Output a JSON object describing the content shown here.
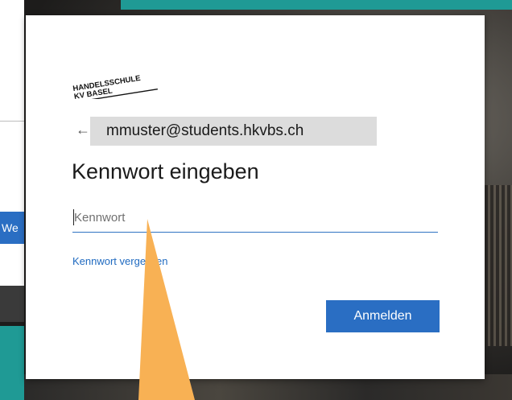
{
  "background": {
    "left_button_fragment": "We"
  },
  "logo": {
    "line1": "HANDELSSCHULE",
    "line2": "KV BASEL"
  },
  "header": {
    "back_icon": "arrow-left-icon",
    "account": "mmuster@students.hkvbs.ch"
  },
  "main": {
    "title": "Kennwort eingeben",
    "password": {
      "value": "",
      "placeholder": "Kennwort"
    },
    "forgot_link": "Kennwort vergessen",
    "signin_button": "Anmelden"
  },
  "colors": {
    "accent": "#2a6ec3",
    "teal": "#1f9a95",
    "pointer": "#f8b154"
  }
}
